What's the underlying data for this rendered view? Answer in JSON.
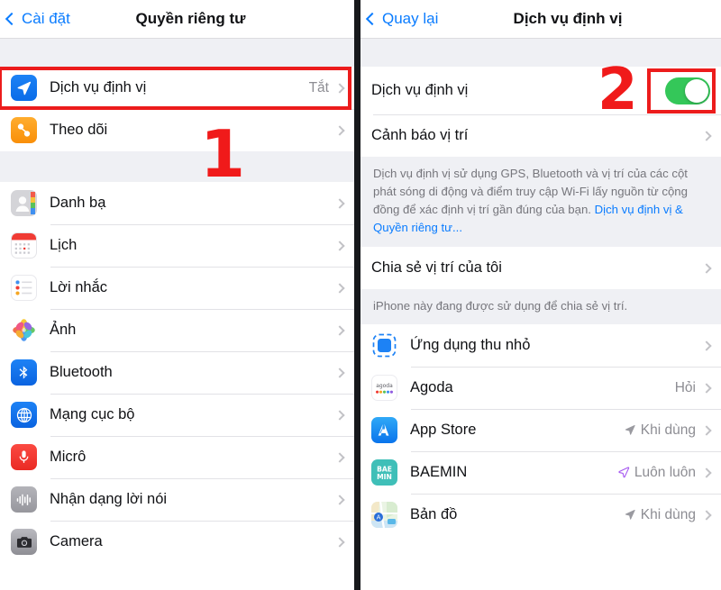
{
  "left_panel": {
    "navbar": {
      "back_label": "Cài đặt",
      "title": "Quyền riêng tư",
      "back_icon": "chevron-left-icon"
    },
    "group_1": [
      {
        "icon": "location-services-icon",
        "label": "Dịch vụ định vị",
        "value": "Tắt",
        "chevron": true
      },
      {
        "icon": "tracking-icon",
        "label": "Theo dõi",
        "value": "",
        "chevron": true
      }
    ],
    "group_2": [
      {
        "icon": "contacts-icon",
        "label": "Danh bạ",
        "value": "",
        "chevron": true
      },
      {
        "icon": "calendar-icon",
        "label": "Lịch",
        "value": "",
        "chevron": true
      },
      {
        "icon": "reminders-icon",
        "label": "Lời nhắc",
        "value": "",
        "chevron": true
      },
      {
        "icon": "photos-icon",
        "label": "Ảnh",
        "value": "",
        "chevron": true
      },
      {
        "icon": "bluetooth-icon",
        "label": "Bluetooth",
        "value": "",
        "chevron": true
      },
      {
        "icon": "local-network-icon",
        "label": "Mạng cục bộ",
        "value": "",
        "chevron": true
      },
      {
        "icon": "microphone-icon",
        "label": "Micrô",
        "value": "",
        "chevron": true
      },
      {
        "icon": "speech-recognition-icon",
        "label": "Nhận dạng lời nói",
        "value": "",
        "chevron": true
      },
      {
        "icon": "camera-icon",
        "label": "Camera",
        "value": "",
        "chevron": true
      }
    ]
  },
  "right_panel": {
    "navbar": {
      "back_label": "Quay lại",
      "title": "Dịch vụ định vị",
      "back_icon": "chevron-left-icon"
    },
    "group_1": [
      {
        "label": "Dịch vụ định vị",
        "control": "toggle",
        "toggle_on": true
      },
      {
        "label": "Cảnh báo vị trí",
        "control": "chevron"
      }
    ],
    "description": {
      "text_before_link": "Dịch vụ định vị sử dụng GPS, Bluetooth và vị trí của các cột phát sóng di động và điểm truy cập Wi-Fi lấy nguồn từ cộng đồng để xác định vị trí gần đúng của bạn. ",
      "link_text": "Dịch vụ định vị & Quyền riêng tư..."
    },
    "group_2": [
      {
        "label": "Chia sẻ vị trí của tôi",
        "control": "chevron"
      }
    ],
    "share_footnote": "iPhone này đang được sử dụng để chia sẻ vị trí.",
    "apps": [
      {
        "icon": "app-clips-icon",
        "label": "Ứng dụng thu nhỏ",
        "value": "",
        "arrow": "none"
      },
      {
        "icon": "agoda-icon",
        "label": "Agoda",
        "value": "Hỏi",
        "arrow": "none"
      },
      {
        "icon": "app-store-icon",
        "label": "App Store",
        "value": "Khi dùng",
        "arrow": "gray"
      },
      {
        "icon": "baemin-icon",
        "label": "BAEMIN",
        "value": "Luôn luôn",
        "arrow": "purple"
      },
      {
        "icon": "maps-icon",
        "label": "Bản đồ",
        "value": "Khi dùng",
        "arrow": "gray"
      }
    ]
  },
  "annotations": {
    "step_one": "1",
    "step_two": "2",
    "highlight_color": "#ec1c1c"
  }
}
